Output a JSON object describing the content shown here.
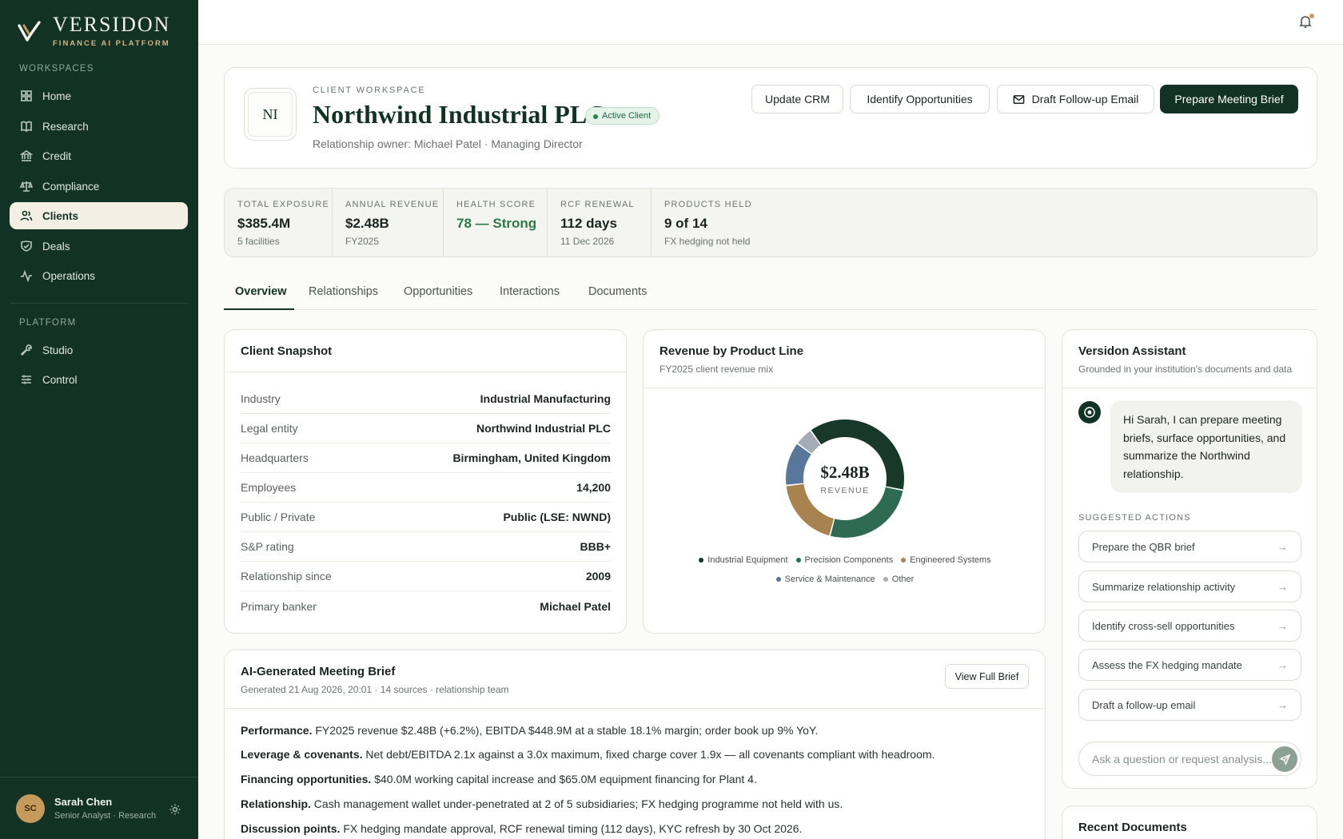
{
  "brand": {
    "name": "VERSIDON",
    "tagline": "FINANCE AI PLATFORM"
  },
  "sidebar": {
    "workspaces_label": "WORKSPACES",
    "workspaces": [
      {
        "label": "Home",
        "icon": "grid-icon"
      },
      {
        "label": "Research",
        "icon": "book-icon"
      },
      {
        "label": "Credit",
        "icon": "bank-icon"
      },
      {
        "label": "Compliance",
        "icon": "scales-icon"
      },
      {
        "label": "Clients",
        "icon": "users-icon",
        "active": true
      },
      {
        "label": "Deals",
        "icon": "handshake-icon"
      },
      {
        "label": "Operations",
        "icon": "activity-icon"
      }
    ],
    "platform_label": "PLATFORM",
    "platform": [
      {
        "label": "Studio",
        "icon": "wrench-icon"
      },
      {
        "label": "Control",
        "icon": "sliders-icon"
      }
    ],
    "user": {
      "initials": "SC",
      "name": "Sarah Chen",
      "role": "Senior Analyst · Research"
    }
  },
  "header": {
    "logo_initials": "NI",
    "eyebrow": "CLIENT WORKSPACE",
    "client_name": "Northwind Industrial PLC",
    "status_badge": "Active Client",
    "owner": "Relationship owner: Michael Patel · Managing Director",
    "actions": {
      "update_crm": "Update CRM",
      "identify_opps": "Identify Opportunities",
      "draft_email": "Draft Follow-up Email",
      "prepare_brief": "Prepare Meeting Brief"
    }
  },
  "kpis": [
    {
      "label": "TOTAL EXPOSURE",
      "value": "$385.4M",
      "sub": "5 facilities"
    },
    {
      "label": "ANNUAL REVENUE",
      "value": "$2.48B",
      "sub": "FY2025"
    },
    {
      "label": "HEALTH SCORE",
      "value": "78 — Strong",
      "sub": ""
    },
    {
      "label": "RCF RENEWAL",
      "value": "112 days",
      "sub": "11 Dec 2026"
    },
    {
      "label": "PRODUCTS HELD",
      "value": "9 of 14",
      "sub": "FX hedging not held"
    }
  ],
  "tabs": [
    "Overview",
    "Relationships",
    "Opportunities",
    "Interactions",
    "Documents"
  ],
  "snapshot": {
    "title": "Client Snapshot",
    "rows": [
      {
        "k": "Industry",
        "v": "Industrial Manufacturing"
      },
      {
        "k": "Legal entity",
        "v": "Northwind Industrial PLC"
      },
      {
        "k": "Headquarters",
        "v": "Birmingham, United Kingdom"
      },
      {
        "k": "Employees",
        "v": "14,200"
      },
      {
        "k": "Public / Private",
        "v": "Public (LSE: NWND)"
      },
      {
        "k": "S&P rating",
        "v": "BBB+"
      },
      {
        "k": "Relationship since",
        "v": "2009"
      },
      {
        "k": "Primary banker",
        "v": "Michael Patel"
      }
    ]
  },
  "revenue": {
    "title": "Revenue by Product Line",
    "subtitle": "FY2025 client revenue mix",
    "center_value": "$2.48B",
    "center_label": "REVENUE"
  },
  "chart_data": {
    "type": "pie",
    "title": "Revenue by Product Line",
    "subtitle": "FY2025 client revenue mix",
    "series": [
      {
        "name": "Industrial Equipment",
        "value": 38,
        "color": "#17382b"
      },
      {
        "name": "Precision Components",
        "value": 26,
        "color": "#2e6b52"
      },
      {
        "name": "Engineered Systems",
        "value": 19,
        "color": "#a8834f"
      },
      {
        "name": "Service & Maintenance",
        "value": 12,
        "color": "#58779a"
      },
      {
        "name": "Other",
        "value": 5,
        "color": "#a6acb3"
      }
    ]
  },
  "assistant": {
    "title": "Versidon Assistant",
    "subtitle": "Grounded in your institution's documents and data",
    "greeting": "Hi Sarah, I can prepare meeting briefs, surface opportunities, and summarize the Northwind relationship.",
    "suggested_label": "SUGGESTED ACTIONS",
    "suggestions": [
      "Prepare the QBR brief",
      "Summarize relationship activity",
      "Identify cross-sell opportunities",
      "Assess the FX hedging mandate",
      "Draft a follow-up email"
    ],
    "ask_placeholder": "Ask a question or request analysis..."
  },
  "brief": {
    "title": "AI-Generated Meeting Brief",
    "meta": "Generated 21 Aug 2026, 20:01 · 14 sources · relationship team",
    "view_button": "View Full Brief",
    "points": [
      {
        "head": "Performance.",
        "text": "FY2025 revenue $2.48B (+6.2%), EBITDA $448.9M at a stable 18.1% margin; order book up 9% YoY."
      },
      {
        "head": "Leverage & covenants.",
        "text": "Net debt/EBITDA 2.1x against a 3.0x maximum, fixed charge cover 1.9x — all covenants compliant with headroom."
      },
      {
        "head": "Financing opportunities.",
        "text": "$40.0M working capital increase and $65.0M equipment financing for Plant 4."
      },
      {
        "head": "Relationship.",
        "text": "Cash management wallet under-penetrated at 2 of 5 subsidiaries; FX hedging programme not held with us."
      },
      {
        "head": "Discussion points.",
        "text": "FX hedging mandate approval, RCF renewal timing (112 days), KYC refresh by 30 Oct 2026."
      }
    ]
  },
  "recent_docs": {
    "title": "Recent Documents"
  }
}
